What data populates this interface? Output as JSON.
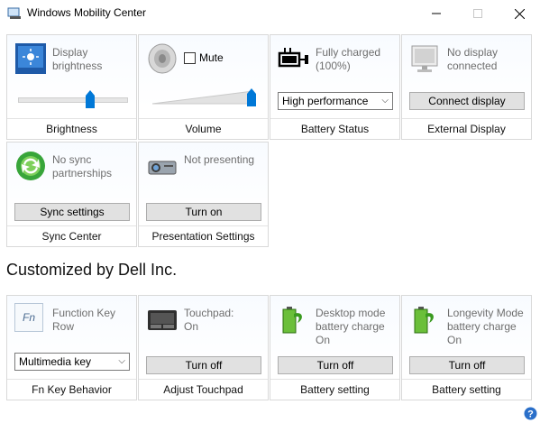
{
  "window": {
    "title": "Windows Mobility Center"
  },
  "tiles": {
    "brightness": {
      "status": "Display brightness",
      "footer": "Brightness",
      "slider_level": 0.68
    },
    "volume": {
      "mute_label": "Mute",
      "footer": "Volume",
      "slider_level": 0.95
    },
    "battery": {
      "status": "Fully charged (100%)",
      "select_value": "High performance",
      "footer": "Battery Status"
    },
    "external": {
      "status": "No display connected",
      "button": "Connect display",
      "footer": "External Display"
    },
    "sync": {
      "status": "No sync partnerships",
      "button": "Sync settings",
      "footer": "Sync Center"
    },
    "presentation": {
      "status": "Not presenting",
      "button": "Turn on",
      "footer": "Presentation Settings"
    }
  },
  "custom_section": {
    "title": "Customized by Dell Inc.",
    "tiles": {
      "fnkey": {
        "status": "Function Key Row",
        "select_value": "Multimedia key",
        "footer": "Fn Key Behavior",
        "icon_text": "Fn"
      },
      "touchpad": {
        "status_line1": "Touchpad:",
        "status_line2": "On",
        "button": "Turn off",
        "footer": "Adjust Touchpad"
      },
      "desktop_mode": {
        "status_line1": "Desktop mode battery charge",
        "status_line2": "On",
        "button": "Turn off",
        "footer": "Battery setting"
      },
      "longevity": {
        "status_line1": "Longevity Mode battery charge",
        "status_line2": "On",
        "button": "Turn off",
        "footer": "Battery setting"
      }
    }
  },
  "help": {
    "glyph": "?"
  }
}
